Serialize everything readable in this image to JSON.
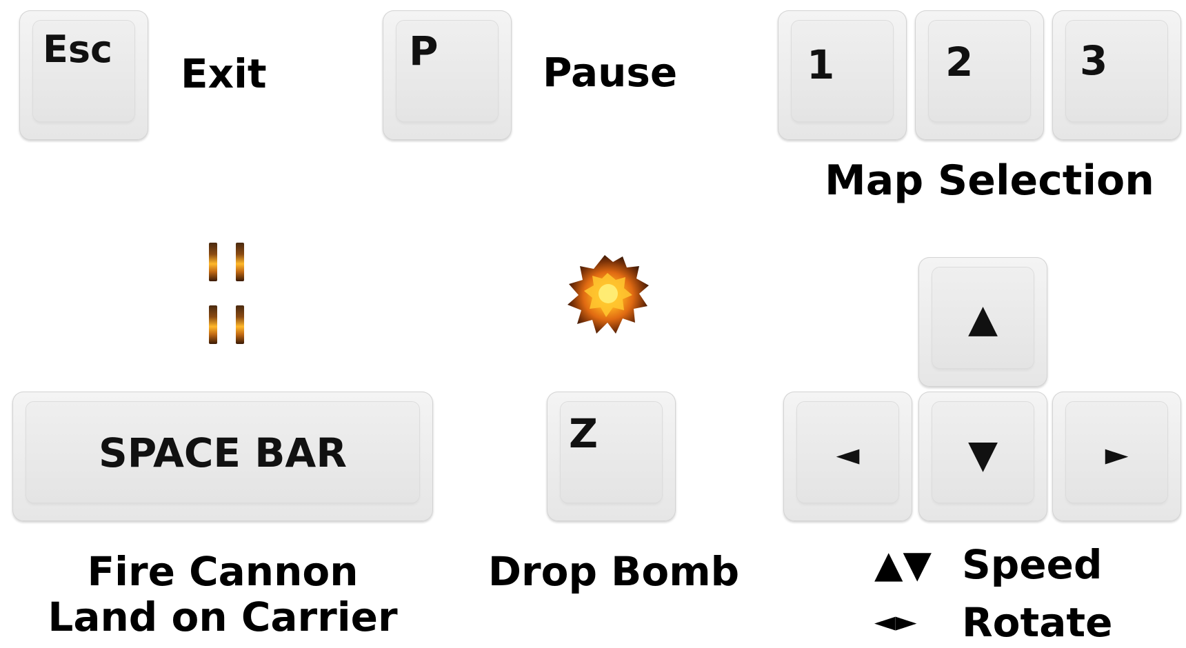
{
  "keys": {
    "esc": "Esc",
    "p": "P",
    "one": "1",
    "two": "2",
    "three": "3",
    "space": "SPACE BAR",
    "z": "Z",
    "up": "▲",
    "down": "▼",
    "left": "◄",
    "right": "►"
  },
  "labels": {
    "exit": "Exit",
    "pause": "Pause",
    "map_selection": "Map Selection",
    "fire_cannon": "Fire Cannon",
    "land_on_carrier": "Land on Carrier",
    "drop_bomb": "Drop Bomb",
    "speed_glyphs": "▲▼",
    "speed": "Speed",
    "rotate_glyphs": "◄►",
    "rotate": "Rotate"
  },
  "icons": {
    "cannon_shots": "cannon-bullet-icon",
    "bomb": "explosion-icon"
  },
  "colors": {
    "key_base": "#e6e6e6",
    "key_face": "#efefef",
    "text": "#000000",
    "bullet_glow": "#ffb82a",
    "explosion_core": "#ffd21a"
  }
}
